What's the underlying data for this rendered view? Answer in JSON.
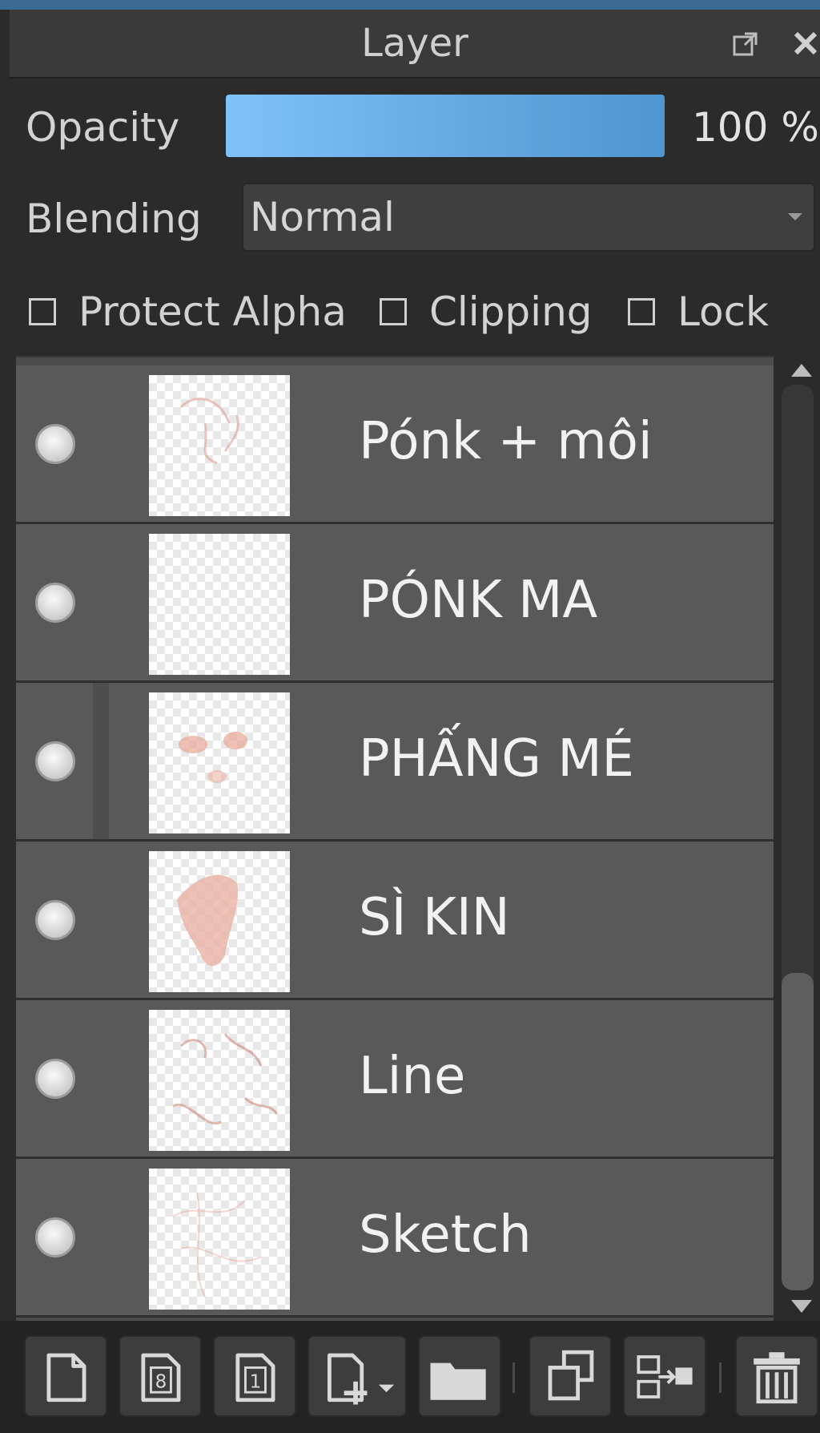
{
  "panel": {
    "title": "Layer",
    "detach_icon": "detach-icon",
    "close_icon": "close-icon",
    "accent": "#3a6a92"
  },
  "opacity": {
    "label": "Opacity",
    "value_text": "100 %",
    "fraction": 1.0,
    "fill_color_start": "#7fc2fa",
    "fill_color_end": "#4f95cf"
  },
  "blending": {
    "label": "Blending",
    "selected": "Normal"
  },
  "options": {
    "protect_alpha": "Protect Alpha",
    "clipping": "Clipping",
    "lock": "Lock"
  },
  "layers": [
    {
      "name": "Pónk + môi",
      "visible": true
    },
    {
      "name": "PÓNK MA",
      "visible": true
    },
    {
      "name": "PHẤNG MÉ",
      "visible": true
    },
    {
      "name": "SÌ KIN",
      "visible": true
    },
    {
      "name": "Line",
      "visible": true
    },
    {
      "name": "Sketch",
      "visible": true
    }
  ],
  "toolbar": {
    "buttons": [
      "new-layer-icon",
      "new-8bit-layer-icon",
      "new-1bit-layer-icon",
      "add-layer-menu-icon",
      "new-folder-icon",
      "duplicate-layer-icon",
      "merge-layer-icon",
      "delete-layer-icon"
    ]
  }
}
